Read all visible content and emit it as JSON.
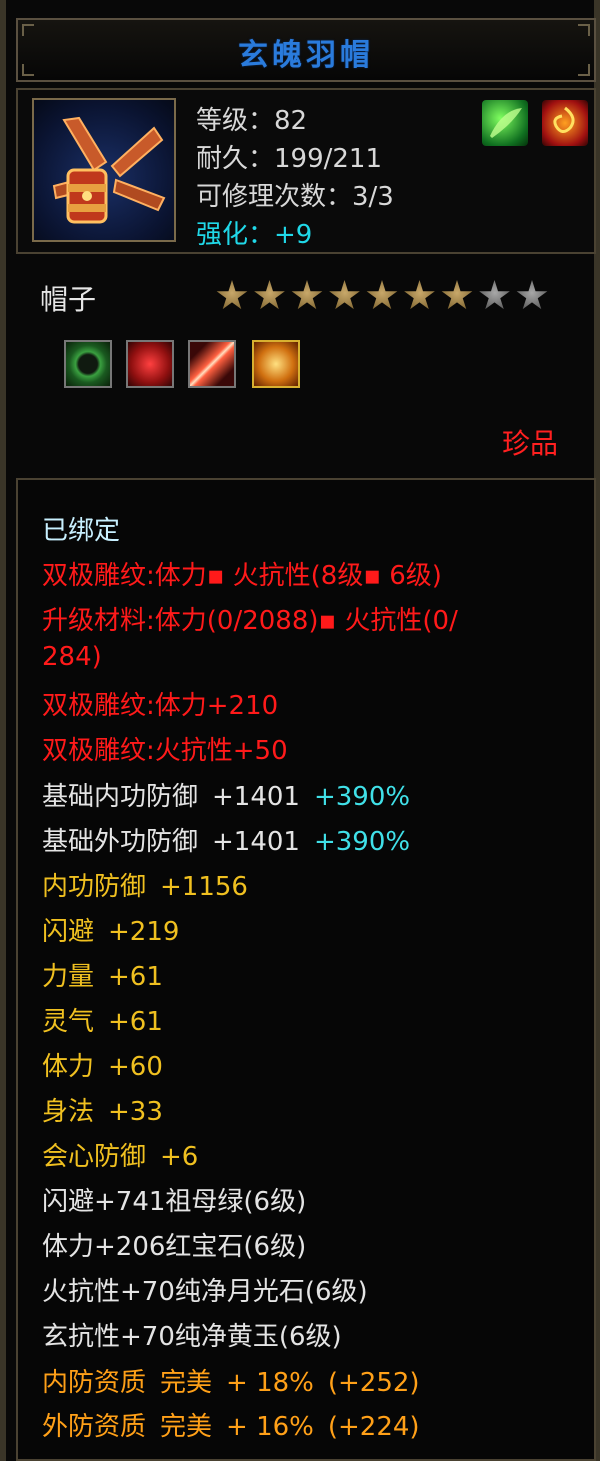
{
  "title": "玄魄羽帽",
  "stats": {
    "level": "等级：82",
    "durability": "耐久：199/211",
    "repair": "可修理次数：3/3",
    "enhance": "强化：+9"
  },
  "category": "帽子",
  "stars": {
    "filled": 7,
    "total": 9
  },
  "rarity": "珍品",
  "bound": "已绑定",
  "red_lines": [
    "双极雕纹:体力▪ 火抗性(8级▪ 6级)",
    "升级材料:体力(0/2088)▪ 火抗性(0/",
    "284)",
    "双极雕纹:体力+210",
    "双极雕纹:火抗性+50"
  ],
  "base_defense": [
    {
      "label": "基础内功防御",
      "value": "+1401",
      "bonus": "+390%"
    },
    {
      "label": "基础外功防御",
      "value": "+1401",
      "bonus": "+390%"
    }
  ],
  "attributes": [
    {
      "label": "内功防御",
      "value": "+1156"
    },
    {
      "label": "闪避",
      "value": "+219"
    },
    {
      "label": "力量",
      "value": "+61"
    },
    {
      "label": "灵气",
      "value": "+61"
    },
    {
      "label": "体力",
      "value": "+60"
    },
    {
      "label": "身法",
      "value": "+33"
    },
    {
      "label": "会心防御",
      "value": "+6"
    }
  ],
  "gems": [
    "闪避+741祖母绿(6级)",
    "体力+206红宝石(6级)",
    "火抗性+70纯净月光石(6级)",
    "玄抗性+70纯净黄玉(6级)"
  ],
  "qualities": [
    {
      "label": "内防资质",
      "grade": "完美",
      "pct": "+ 18%",
      "extra": "(+252)"
    },
    {
      "label": "外防资质",
      "grade": "完美",
      "pct": "+ 16%",
      "extra": "(+224)"
    }
  ],
  "colors": {
    "title": "#2a7bdc",
    "enhance": "#20d8e8",
    "red": "#ff1a1a",
    "yellow": "#f0c020",
    "orange": "#ffa018",
    "cyan": "#40e0e8"
  },
  "icons": {
    "top_right": [
      "green-feather-icon",
      "fire-swirl-icon"
    ],
    "sockets": [
      "jade-ring-icon",
      "red-gem-icon",
      "sword-slash-icon",
      "gold-coin-icon"
    ]
  }
}
